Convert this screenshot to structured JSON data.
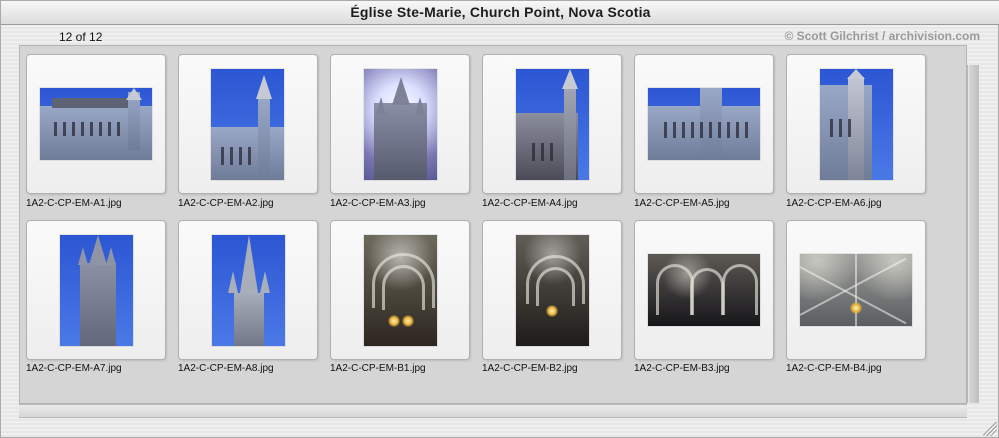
{
  "window": {
    "title": "Église Ste-Marie, Church Point, Nova Scotia"
  },
  "header": {
    "count": "12 of 12",
    "credit": "© Scott Gilchrist / archivision.com"
  },
  "grid": {
    "items": [
      {
        "caption": "1A2-C-CP-EM-A1.jpg",
        "icon": "church-side-view"
      },
      {
        "caption": "1A2-C-CP-EM-A2.jpg",
        "icon": "church-tower-side-view"
      },
      {
        "caption": "1A2-C-CP-EM-A3.jpg",
        "icon": "church-facade-backlit"
      },
      {
        "caption": "1A2-C-CP-EM-A4.jpg",
        "icon": "church-tower-corner-view"
      },
      {
        "caption": "1A2-C-CP-EM-A5.jpg",
        "icon": "church-side-elevation"
      },
      {
        "caption": "1A2-C-CP-EM-A6.jpg",
        "icon": "church-corner-tower"
      },
      {
        "caption": "1A2-C-CP-EM-A7.jpg",
        "icon": "spire-cluster-view"
      },
      {
        "caption": "1A2-C-CP-EM-A8.jpg",
        "icon": "spire-closeup-view"
      },
      {
        "caption": "1A2-C-CP-EM-B1.jpg",
        "icon": "interior-nave-view"
      },
      {
        "caption": "1A2-C-CP-EM-B2.jpg",
        "icon": "interior-aisle-view"
      },
      {
        "caption": "1A2-C-CP-EM-B3.jpg",
        "icon": "interior-arches-view"
      },
      {
        "caption": "1A2-C-CP-EM-B4.jpg",
        "icon": "ceiling-vault-view"
      }
    ]
  }
}
